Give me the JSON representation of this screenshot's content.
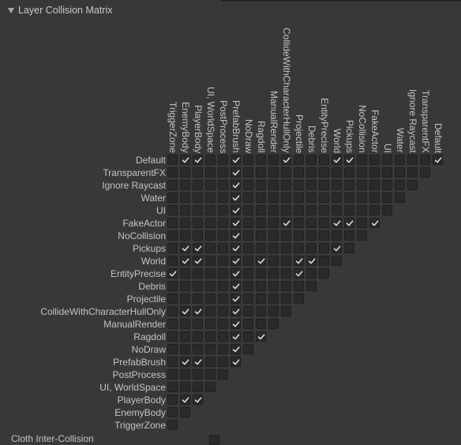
{
  "section": {
    "title": "Layer Collision Matrix",
    "expanded": true
  },
  "layers": [
    "Default",
    "TransparentFX",
    "Ignore Raycast",
    "Water",
    "UI",
    "FakeActor",
    "NoCollision",
    "Pickups",
    "World",
    "EntityPrecise",
    "Debris",
    "Projectile",
    "CollideWithCharacterHullOnly",
    "ManualRender",
    "Ragdoll",
    "NoDraw",
    "PrefabBrush",
    "PostProcess",
    "UI, WorldSpace",
    "PlayerBody",
    "EnemyBody",
    "TriggerZone"
  ],
  "columns": [
    "TriggerZone",
    "EnemyBody",
    "PlayerBody",
    "UI, WorldSpace",
    "PostProcess",
    "PrefabBrush",
    "NoDraw",
    "Ragdoll",
    "ManualRender",
    "CollideWithCharacterHullOnly",
    "Projectile",
    "Debris",
    "EntityPrecise",
    "World",
    "Pickups",
    "NoCollision",
    "FakeActor",
    "UI",
    "Water",
    "Ignore Raycast",
    "TransparentFX",
    "Default"
  ],
  "checked": {
    "Default": [
      1,
      2,
      5,
      9,
      13,
      14,
      21
    ],
    "TransparentFX": [
      5
    ],
    "Ignore Raycast": [
      5
    ],
    "Water": [
      5
    ],
    "UI": [
      5
    ],
    "FakeActor": [
      5,
      9,
      13,
      14,
      16
    ],
    "NoCollision": [
      5
    ],
    "Pickups": [
      1,
      2,
      5,
      13
    ],
    "World": [
      1,
      2,
      5,
      7,
      10,
      11
    ],
    "EntityPrecise": [
      0,
      5,
      10
    ],
    "Debris": [
      5
    ],
    "Projectile": [
      5
    ],
    "CollideWithCharacterHullOnly": [
      1,
      2,
      5
    ],
    "ManualRender": [
      5
    ],
    "Ragdoll": [
      5,
      7
    ],
    "NoDraw": [
      5
    ],
    "PrefabBrush": [
      1,
      2,
      5
    ],
    "PostProcess": [],
    "UI, WorldSpace": [],
    "PlayerBody": [
      1,
      2
    ],
    "EnemyBody": [],
    "TriggerZone": []
  },
  "footer": {
    "label": "Cloth Inter-Collision",
    "enabled": false
  },
  "colors": {
    "background": "#383838",
    "cell": "#2a2a2a",
    "check": "#e0e0e0",
    "text": "#c4c4c4"
  }
}
